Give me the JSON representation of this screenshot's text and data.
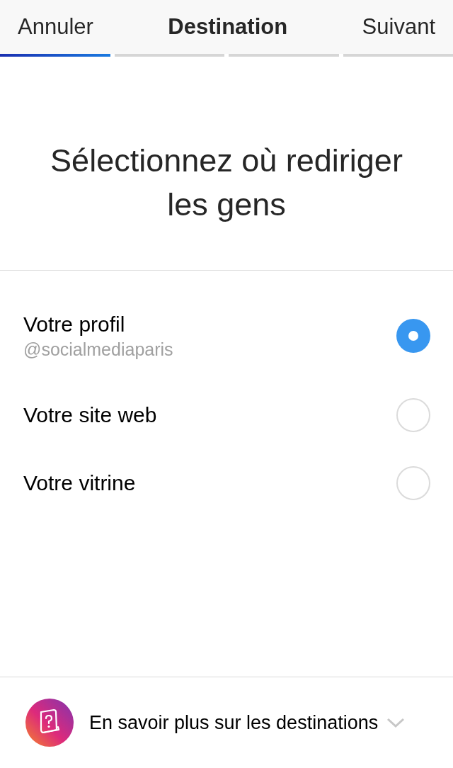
{
  "header": {
    "cancel": "Annuler",
    "title": "Destination",
    "next": "Suivant"
  },
  "progress": [
    {
      "complete": true
    },
    {
      "complete": false
    },
    {
      "complete": false
    },
    {
      "complete": false
    }
  ],
  "heading": "Sélectionnez où rediriger les gens",
  "options": [
    {
      "label": "Votre profil",
      "subtitle": "@socialmediaparis",
      "selected": true
    },
    {
      "label": "Votre site web",
      "selected": false
    },
    {
      "label": "Votre vitrine",
      "selected": false
    }
  ],
  "footer": {
    "label": "En savoir plus sur les destinations",
    "expanded": false
  }
}
